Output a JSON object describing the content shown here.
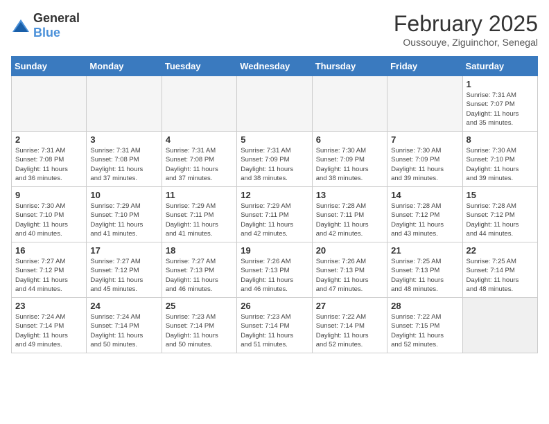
{
  "logo": {
    "general": "General",
    "blue": "Blue"
  },
  "header": {
    "month": "February 2025",
    "location": "Oussouye, Ziguinchor, Senegal"
  },
  "weekdays": [
    "Sunday",
    "Monday",
    "Tuesday",
    "Wednesday",
    "Thursday",
    "Friday",
    "Saturday"
  ],
  "weeks": [
    [
      {
        "day": "",
        "info": ""
      },
      {
        "day": "",
        "info": ""
      },
      {
        "day": "",
        "info": ""
      },
      {
        "day": "",
        "info": ""
      },
      {
        "day": "",
        "info": ""
      },
      {
        "day": "",
        "info": ""
      },
      {
        "day": "1",
        "info": "Sunrise: 7:31 AM\nSunset: 7:07 PM\nDaylight: 11 hours\nand 35 minutes."
      }
    ],
    [
      {
        "day": "2",
        "info": "Sunrise: 7:31 AM\nSunset: 7:08 PM\nDaylight: 11 hours\nand 36 minutes."
      },
      {
        "day": "3",
        "info": "Sunrise: 7:31 AM\nSunset: 7:08 PM\nDaylight: 11 hours\nand 37 minutes."
      },
      {
        "day": "4",
        "info": "Sunrise: 7:31 AM\nSunset: 7:08 PM\nDaylight: 11 hours\nand 37 minutes."
      },
      {
        "day": "5",
        "info": "Sunrise: 7:31 AM\nSunset: 7:09 PM\nDaylight: 11 hours\nand 38 minutes."
      },
      {
        "day": "6",
        "info": "Sunrise: 7:30 AM\nSunset: 7:09 PM\nDaylight: 11 hours\nand 38 minutes."
      },
      {
        "day": "7",
        "info": "Sunrise: 7:30 AM\nSunset: 7:09 PM\nDaylight: 11 hours\nand 39 minutes."
      },
      {
        "day": "8",
        "info": "Sunrise: 7:30 AM\nSunset: 7:10 PM\nDaylight: 11 hours\nand 39 minutes."
      }
    ],
    [
      {
        "day": "9",
        "info": "Sunrise: 7:30 AM\nSunset: 7:10 PM\nDaylight: 11 hours\nand 40 minutes."
      },
      {
        "day": "10",
        "info": "Sunrise: 7:29 AM\nSunset: 7:10 PM\nDaylight: 11 hours\nand 41 minutes."
      },
      {
        "day": "11",
        "info": "Sunrise: 7:29 AM\nSunset: 7:11 PM\nDaylight: 11 hours\nand 41 minutes."
      },
      {
        "day": "12",
        "info": "Sunrise: 7:29 AM\nSunset: 7:11 PM\nDaylight: 11 hours\nand 42 minutes."
      },
      {
        "day": "13",
        "info": "Sunrise: 7:28 AM\nSunset: 7:11 PM\nDaylight: 11 hours\nand 42 minutes."
      },
      {
        "day": "14",
        "info": "Sunrise: 7:28 AM\nSunset: 7:12 PM\nDaylight: 11 hours\nand 43 minutes."
      },
      {
        "day": "15",
        "info": "Sunrise: 7:28 AM\nSunset: 7:12 PM\nDaylight: 11 hours\nand 44 minutes."
      }
    ],
    [
      {
        "day": "16",
        "info": "Sunrise: 7:27 AM\nSunset: 7:12 PM\nDaylight: 11 hours\nand 44 minutes."
      },
      {
        "day": "17",
        "info": "Sunrise: 7:27 AM\nSunset: 7:12 PM\nDaylight: 11 hours\nand 45 minutes."
      },
      {
        "day": "18",
        "info": "Sunrise: 7:27 AM\nSunset: 7:13 PM\nDaylight: 11 hours\nand 46 minutes."
      },
      {
        "day": "19",
        "info": "Sunrise: 7:26 AM\nSunset: 7:13 PM\nDaylight: 11 hours\nand 46 minutes."
      },
      {
        "day": "20",
        "info": "Sunrise: 7:26 AM\nSunset: 7:13 PM\nDaylight: 11 hours\nand 47 minutes."
      },
      {
        "day": "21",
        "info": "Sunrise: 7:25 AM\nSunset: 7:13 PM\nDaylight: 11 hours\nand 48 minutes."
      },
      {
        "day": "22",
        "info": "Sunrise: 7:25 AM\nSunset: 7:14 PM\nDaylight: 11 hours\nand 48 minutes."
      }
    ],
    [
      {
        "day": "23",
        "info": "Sunrise: 7:24 AM\nSunset: 7:14 PM\nDaylight: 11 hours\nand 49 minutes."
      },
      {
        "day": "24",
        "info": "Sunrise: 7:24 AM\nSunset: 7:14 PM\nDaylight: 11 hours\nand 50 minutes."
      },
      {
        "day": "25",
        "info": "Sunrise: 7:23 AM\nSunset: 7:14 PM\nDaylight: 11 hours\nand 50 minutes."
      },
      {
        "day": "26",
        "info": "Sunrise: 7:23 AM\nSunset: 7:14 PM\nDaylight: 11 hours\nand 51 minutes."
      },
      {
        "day": "27",
        "info": "Sunrise: 7:22 AM\nSunset: 7:14 PM\nDaylight: 11 hours\nand 52 minutes."
      },
      {
        "day": "28",
        "info": "Sunrise: 7:22 AM\nSunset: 7:15 PM\nDaylight: 11 hours\nand 52 minutes."
      },
      {
        "day": "",
        "info": ""
      }
    ]
  ]
}
